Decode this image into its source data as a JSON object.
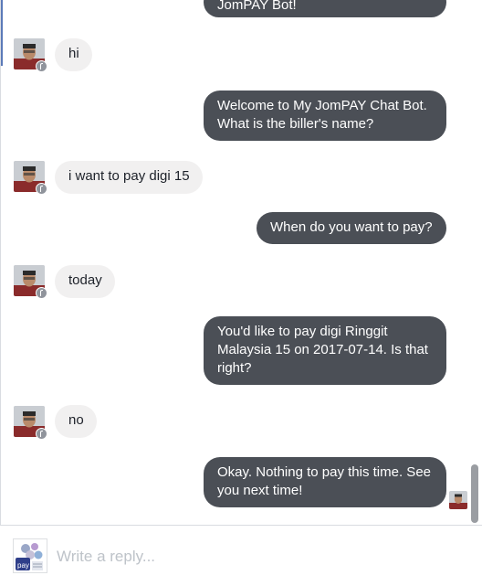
{
  "messages": [
    {
      "from": "bot",
      "text": "JomPAY Bot!"
    },
    {
      "from": "user",
      "text": "hi"
    },
    {
      "from": "bot",
      "line1": "Welcome to My JomPAY Chat Bot.",
      "line2": "What is the biller's name?"
    },
    {
      "from": "user",
      "text": "i want to pay digi 15"
    },
    {
      "from": "bot",
      "text": "When do you want to pay?"
    },
    {
      "from": "user",
      "text": "today"
    },
    {
      "from": "bot",
      "line1": "You'd like to pay digi Ringgit",
      "line2": "Malaysia 15 on 2017-07-14. Is that",
      "line3": "right?"
    },
    {
      "from": "user",
      "text": "no"
    },
    {
      "from": "bot",
      "line1": "Okay. Nothing to pay this time. See",
      "line2": "you next time!"
    }
  ],
  "composer": {
    "placeholder": "Write a reply...",
    "page_thumb_text": "pay"
  },
  "colors": {
    "bot_bubble": "#4b4f56",
    "user_bubble": "#f1f0f0",
    "user_text": "#1d2129",
    "badge": "#90949c"
  },
  "icons": [
    "user-avatar-icon",
    "facebook-badge-icon",
    "read-receipt-avatar-icon",
    "jompay-page-icon"
  ]
}
